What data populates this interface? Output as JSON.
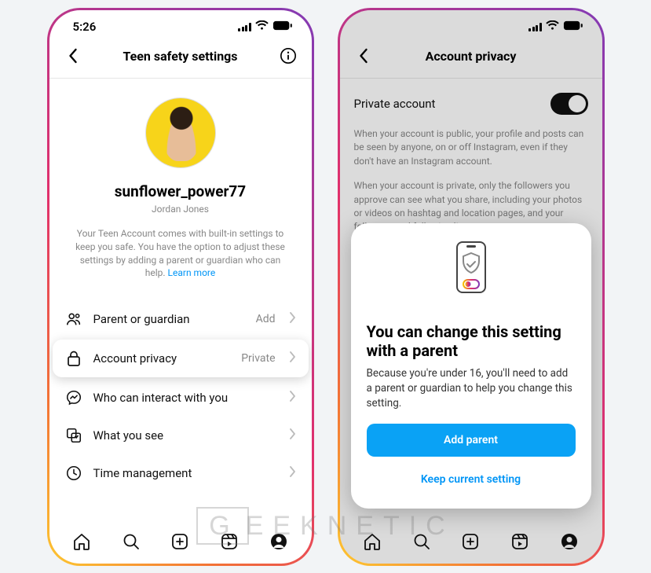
{
  "statusbar": {
    "time": "5:26"
  },
  "phone1": {
    "header": {
      "title": "Teen safety settings"
    },
    "profile": {
      "username": "sunflower_power77",
      "realname": "Jordan Jones",
      "description_a": "Your Teen Account comes with built-in settings to keep you safe. You have the option to adjust these settings by adding a parent or guardian who can help. ",
      "description_link": "Learn more"
    },
    "settings": [
      {
        "label": "Parent or guardian",
        "meta": "Add"
      },
      {
        "label": "Account privacy",
        "meta": "Private"
      },
      {
        "label": "Who can interact with you",
        "meta": ""
      },
      {
        "label": "What you see",
        "meta": ""
      },
      {
        "label": "Time management",
        "meta": ""
      }
    ]
  },
  "phone2": {
    "header": {
      "title": "Account privacy"
    },
    "private_label": "Private account",
    "para1": "When your account is public, your profile and posts can be seen by anyone, on or off Instagram, even if they don't have an Instagram account.",
    "para2": "When your account is private, only the followers you approve can see what you share, including your photos or videos on hashtag and location pages, and your followers and following lists.",
    "modal": {
      "title": "You can change this setting with a parent",
      "body": "Because you're under 16, you'll need to add a parent or guardian to help you change this setting.",
      "primary": "Add parent",
      "secondary": "Keep current setting"
    }
  },
  "watermark": {
    "a": "G",
    "b": "EEKNETIC"
  }
}
